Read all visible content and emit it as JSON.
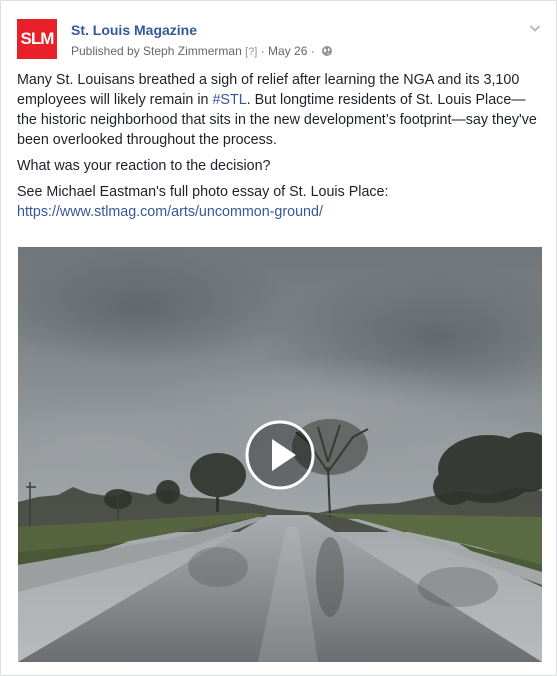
{
  "page": {
    "name": "St. Louis Magazine",
    "logo_text": "SLM",
    "published_by": "Published by Steph Zimmerman",
    "help_marker": "[?]",
    "separator": "·",
    "date": "May 26",
    "privacy_icon": "globe-icon",
    "menu_icon": "chevron-down-icon"
  },
  "post": {
    "para1_before": "Many St. Louisans breathed a sigh of relief after learning the NGA and its 3,100 employees will likely remain in ",
    "hashtag": "#STL",
    "para1_after": ". But longtime residents of St. Louis Place—the historic neighborhood that sits in the new development’s footprint—say they've been overlooked throughout the process.",
    "para2": "What was your reaction to the decision?",
    "para3": "See Michael Eastman's full photo essay of St. Louis Place:",
    "link": "https://www.stlmag.com/arts/uncommon-ground/"
  },
  "video": {
    "play_icon": "play-icon"
  },
  "colors": {
    "brand_red": "#e8202a",
    "link_blue": "#365899",
    "text": "#1d2129",
    "meta": "#616770"
  }
}
